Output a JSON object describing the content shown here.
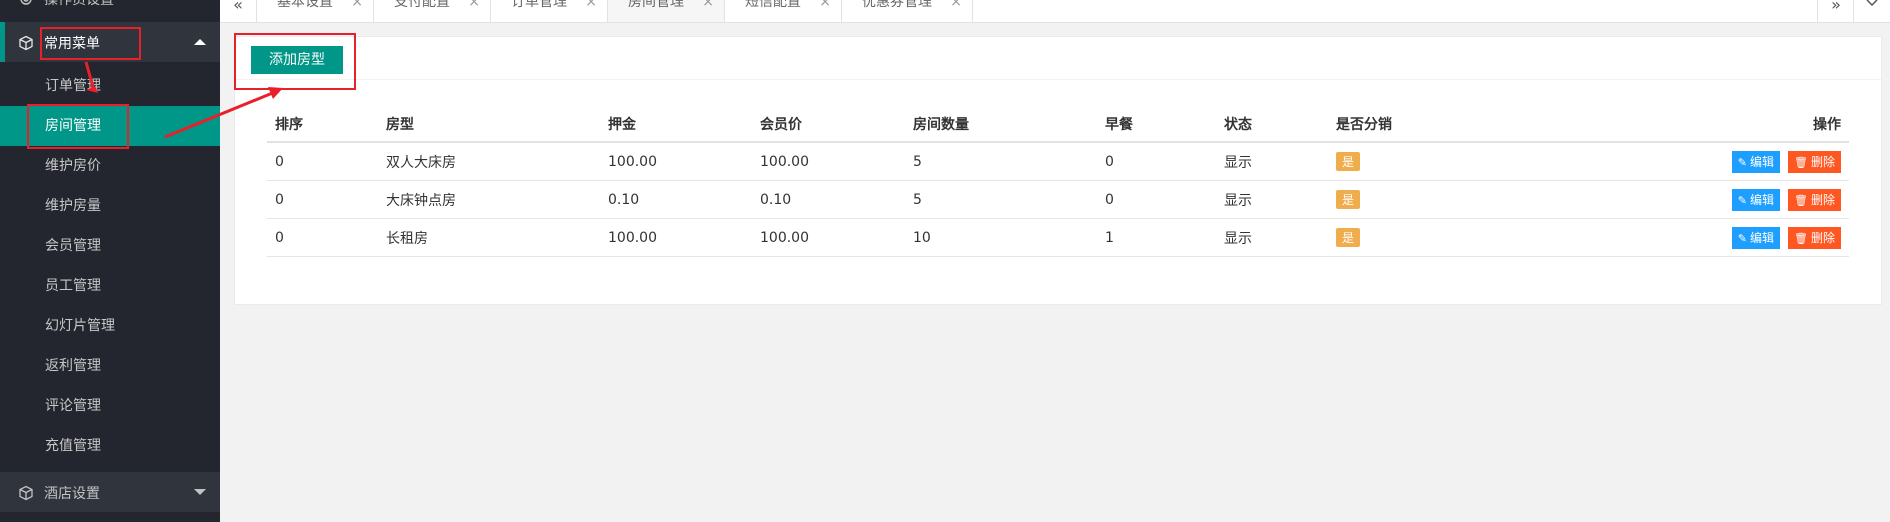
{
  "sidebar": {
    "top_group_label": "操作员设置",
    "common_menu_label": "常用菜单",
    "items": [
      {
        "label": "订单管理"
      },
      {
        "label": "房间管理"
      },
      {
        "label": "维护房价"
      },
      {
        "label": "维护房量"
      },
      {
        "label": "会员管理"
      },
      {
        "label": "员工管理"
      },
      {
        "label": "幻灯片管理"
      },
      {
        "label": "返利管理"
      },
      {
        "label": "评论管理"
      },
      {
        "label": "充值管理"
      }
    ],
    "active_item": "房间管理",
    "hotel_settings_label": "酒店设置"
  },
  "tabs": {
    "prev_icon": "«",
    "next_icon": "»",
    "items": [
      {
        "label": "基本设置",
        "active": false
      },
      {
        "label": "支付配置",
        "active": false
      },
      {
        "label": "订单管理",
        "active": false
      },
      {
        "label": "房间管理",
        "active": true
      },
      {
        "label": "短信配置",
        "active": false
      },
      {
        "label": "优惠券管理",
        "active": false
      }
    ],
    "close_glyph": "×"
  },
  "main": {
    "add_button_label": "添加房型",
    "table": {
      "headers": [
        "排序",
        "房型",
        "押金",
        "会员价",
        "房间数量",
        "早餐",
        "状态",
        "是否分销",
        "操作"
      ],
      "rows": [
        {
          "sort": "0",
          "room_type": "双人大床房",
          "deposit": "100.00",
          "member_price": "100.00",
          "count": "5",
          "breakfast": "0",
          "status": "显示",
          "distribution": "是"
        },
        {
          "sort": "0",
          "room_type": "大床钟点房",
          "deposit": "0.10",
          "member_price": "0.10",
          "count": "5",
          "breakfast": "0",
          "status": "显示",
          "distribution": "是"
        },
        {
          "sort": "0",
          "room_type": "长租房",
          "deposit": "100.00",
          "member_price": "100.00",
          "count": "10",
          "breakfast": "1",
          "status": "显示",
          "distribution": "是"
        }
      ],
      "edit_label": "编辑",
      "delete_label": "删除"
    }
  },
  "colors": {
    "sidebar_bg": "#23262e",
    "accent": "#009688",
    "edit_blue": "#1e9fff",
    "delete_orange": "#ff5722",
    "badge_yellow": "#f0ad4e",
    "annotation_red": "#e8202a"
  }
}
